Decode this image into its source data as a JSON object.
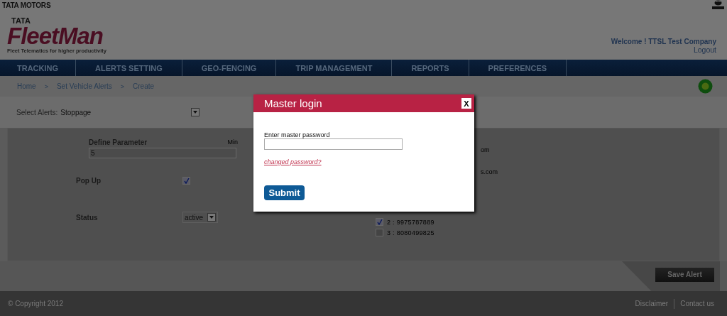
{
  "brand_bar": {
    "company": "TATA MOTORS"
  },
  "header": {
    "logo_top": "TATA",
    "logo_main": "FleetMan",
    "tagline": "Fleet Telematics for higher productivity",
    "welcome": "Welcome ! TTSL Test Company",
    "logout": "Logout"
  },
  "nav": [
    {
      "label": "TRACKING"
    },
    {
      "label": "ALERTS SETTING"
    },
    {
      "label": "GEO-FENCING"
    },
    {
      "label": "TRIP MANAGEMENT"
    },
    {
      "label": "REPORTS"
    },
    {
      "label": "PREFERENCES"
    }
  ],
  "breadcrumb": [
    "Home",
    "Set Vehicle Alerts",
    "Create"
  ],
  "breadcrumb_separator": ">",
  "select_alerts": {
    "label": "Select Alerts:",
    "value": "Stoppage"
  },
  "form": {
    "parameter_label": "Define Parameter",
    "unit": "Min",
    "parameter_value": "5",
    "popup_label": "Pop Up",
    "popup_checked": true,
    "status_label": "Status",
    "status_value": "active"
  },
  "email_fragments": [
    "om",
    "s.com"
  ],
  "phones": [
    {
      "label": "2 : 9975787889",
      "checked": true
    },
    {
      "label": "3 : 8080499825",
      "checked": false
    }
  ],
  "save_button": "Save Alert",
  "footer": {
    "copyright": "© Copyright 2012",
    "links": [
      "Disclaimer",
      "Contact us"
    ]
  },
  "modal": {
    "title": "Master login",
    "close": "X",
    "field_label": "Enter master password",
    "link": "changed password?",
    "submit": "Submit"
  }
}
